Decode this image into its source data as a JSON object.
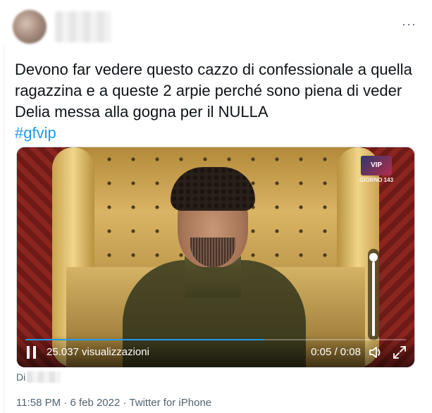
{
  "header": {
    "more_label": "···"
  },
  "tweet": {
    "text": "Devono far vedere questo cazzo di confessionale a quella ragazzina e a queste 2 arpie perché sono piena di veder Delia messa alla gogna per il NULLA",
    "hashtag": "#gfvip"
  },
  "video": {
    "logo_text": "VIP",
    "logo_day": "GIORNO 143",
    "views": "25.037 visualizzazioni",
    "time": "0:05 / 0:08",
    "progress_fraction": 0.625,
    "volume_fraction": 0.9
  },
  "footer": {
    "di_label": "Di",
    "time": "11:58 PM",
    "sep1": " · ",
    "date": "6 feb 2022",
    "sep2": " · ",
    "source": "Twitter for iPhone"
  },
  "colors": {
    "accent": "#1d9bf0",
    "text": "#0f1419",
    "muted": "#536471"
  }
}
